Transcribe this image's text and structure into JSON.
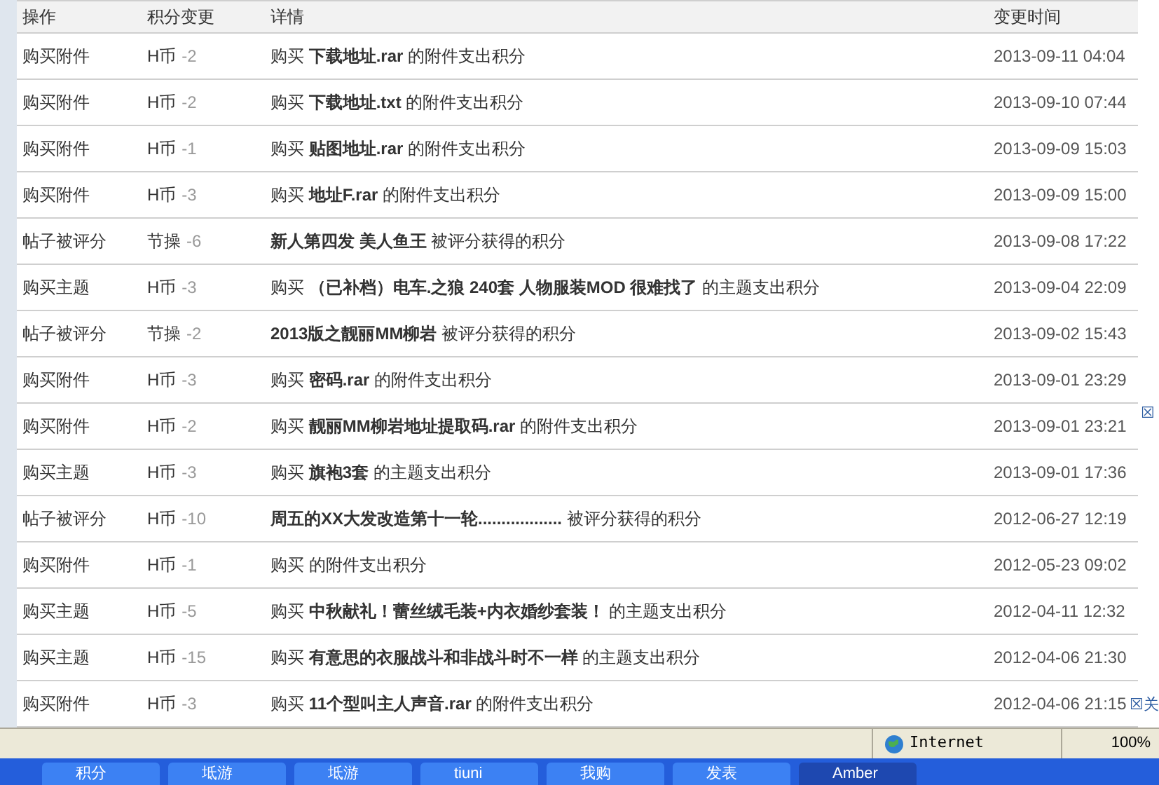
{
  "table": {
    "columns": [
      "操作",
      "积分变更",
      "详情",
      "变更时间"
    ],
    "rows": [
      {
        "action": "购买附件",
        "currency": "H币",
        "amount": "-2",
        "detail": "购买 **下载地址.rar** 的附件支出积分",
        "time": "2013-09-11 04:04"
      },
      {
        "action": "购买附件",
        "currency": "H币",
        "amount": "-2",
        "detail": "购买 **下载地址.txt** 的附件支出积分",
        "time": "2013-09-10 07:44"
      },
      {
        "action": "购买附件",
        "currency": "H币",
        "amount": "-1",
        "detail": "购买 **贴图地址.rar** 的附件支出积分",
        "time": "2013-09-09 15:03"
      },
      {
        "action": "购买附件",
        "currency": "H币",
        "amount": "-3",
        "detail": "购买 **地址F.rar** 的附件支出积分",
        "time": "2013-09-09 15:00"
      },
      {
        "action": "帖子被评分",
        "currency": "节操",
        "amount": "-6",
        "detail": "**新人第四发 美人鱼王** 被评分获得的积分",
        "time": "2013-09-08 17:22"
      },
      {
        "action": "购买主题",
        "currency": "H币",
        "amount": "-3",
        "detail": "购买 **（已补档）电车.之狼 240套 人物服装MOD 很难找了** 的主题支出积分",
        "time": "2013-09-04 22:09"
      },
      {
        "action": "帖子被评分",
        "currency": "节操",
        "amount": "-2",
        "detail": "**2013版之靓丽MM柳岩** 被评分获得的积分",
        "time": "2013-09-02 15:43"
      },
      {
        "action": "购买附件",
        "currency": "H币",
        "amount": "-3",
        "detail": "购买 **密码.rar** 的附件支出积分",
        "time": "2013-09-01 23:29"
      },
      {
        "action": "购买附件",
        "currency": "H币",
        "amount": "-2",
        "detail": "购买 **靓丽MM柳岩地址提取码.rar** 的附件支出积分",
        "time": "2013-09-01 23:21"
      },
      {
        "action": "购买主题",
        "currency": "H币",
        "amount": "-3",
        "detail": "购买 **旗袍3套** 的主题支出积分",
        "time": "2013-09-01 17:36"
      },
      {
        "action": "帖子被评分",
        "currency": "H币",
        "amount": "-10",
        "detail": "**周五的XX大发改造第十一轮..................** 被评分获得的积分",
        "time": "2012-06-27 12:19"
      },
      {
        "action": "购买附件",
        "currency": "H币",
        "amount": "-1",
        "detail": "购买 的附件支出积分",
        "time": "2012-05-23 09:02"
      },
      {
        "action": "购买主题",
        "currency": "H币",
        "amount": "-5",
        "detail": "购买 **中秋献礼！蕾丝绒毛装+内衣婚纱套装！** 的主题支出积分",
        "time": "2012-04-11 12:32"
      },
      {
        "action": "购买主题",
        "currency": "H币",
        "amount": "-15",
        "detail": "购买 **有意思的衣服战斗和非战斗时不一样** 的主题支出积分",
        "time": "2012-04-06 21:30"
      },
      {
        "action": "购买附件",
        "currency": "H币",
        "amount": "-3",
        "detail": "购买 **11个型叫主人声音.rar** 的附件支出积分",
        "time": "2012-04-06 21:15"
      }
    ]
  },
  "ad_close_links": [
    "☒",
    "☒关"
  ],
  "status_bar": {
    "zone": "Internet",
    "zoom": "100%"
  },
  "taskbar": {
    "items": [
      {
        "label": "积分",
        "selected": false
      },
      {
        "label": "坻游",
        "selected": false
      },
      {
        "label": "坻游",
        "selected": false
      },
      {
        "label": "tiuni",
        "selected": false
      },
      {
        "label": "我购",
        "selected": false
      },
      {
        "label": "发表",
        "selected": false
      },
      {
        "label": "Amber",
        "selected": true
      }
    ]
  }
}
